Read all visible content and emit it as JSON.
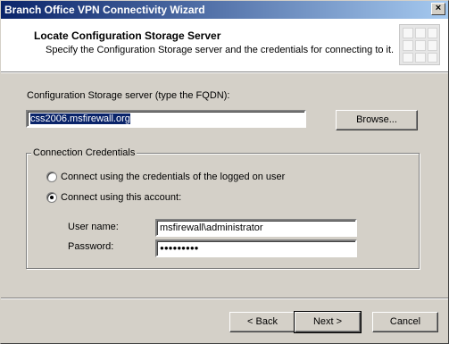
{
  "window": {
    "title": "Branch Office VPN Connectivity Wizard",
    "close_glyph": "×"
  },
  "header": {
    "title": "Locate Configuration Storage Server",
    "subtitle": "Specify the Configuration Storage server and the credentials for connecting to it.",
    "graphic_icon": "wizard-banner-icon"
  },
  "server": {
    "label": "Configuration Storage server (type the FQDN):",
    "value": "css2006.msfirewall.org",
    "browse_label": "Browse..."
  },
  "credentials": {
    "caption": "Connection Credentials",
    "option_logged_on": "Connect using the credentials of the logged on user",
    "option_account": "Connect using this account:",
    "selected_option": "account",
    "username_label": "User name:",
    "username_value": "msfirewall\\administrator",
    "password_label": "Password:",
    "password_value": "●●●●●●●●●"
  },
  "footer": {
    "back_label": "< Back",
    "next_label": "Next >",
    "cancel_label": "Cancel"
  }
}
